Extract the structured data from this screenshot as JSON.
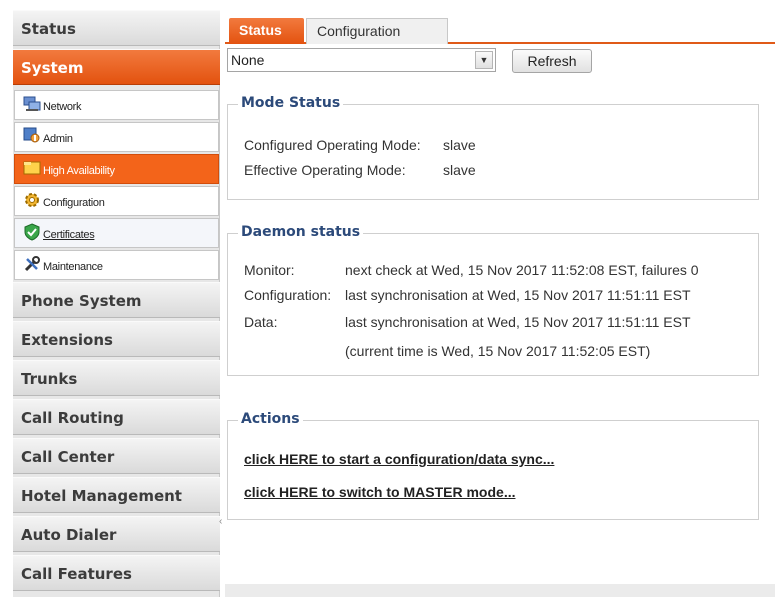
{
  "sidebar": {
    "categories_top": [
      {
        "label": "Status",
        "active": false
      },
      {
        "label": "System",
        "active": true
      }
    ],
    "system_items": [
      {
        "label": "Network",
        "icon": "network-icon",
        "active": false
      },
      {
        "label": "Admin",
        "icon": "admin-icon",
        "active": false
      },
      {
        "label": "High Availability",
        "icon": "high-availability-icon",
        "active": true
      },
      {
        "label": "Configuration",
        "icon": "gear-icon",
        "active": false
      },
      {
        "label": "Certificates",
        "icon": "shield-check-icon",
        "active": false
      },
      {
        "label": "Maintenance",
        "icon": "tools-icon",
        "active": false
      }
    ],
    "categories_bottom": [
      {
        "label": "Phone System"
      },
      {
        "label": "Extensions"
      },
      {
        "label": "Trunks"
      },
      {
        "label": "Call Routing"
      },
      {
        "label": "Call Center"
      },
      {
        "label": "Hotel Management"
      },
      {
        "label": "Auto Dialer"
      },
      {
        "label": "Call Features"
      }
    ]
  },
  "tabs": [
    {
      "label": "Status",
      "active": true
    },
    {
      "label": "Configuration",
      "active": false
    }
  ],
  "toolbar": {
    "select_value": "None",
    "refresh_label": "Refresh"
  },
  "mode_status": {
    "title": "Mode Status",
    "rows": [
      {
        "label": "Configured Operating Mode:",
        "value": "slave"
      },
      {
        "label": "Effective Operating Mode:",
        "value": "slave"
      }
    ]
  },
  "daemon_status": {
    "title": "Daemon status",
    "rows": [
      {
        "label": "Monitor:",
        "value": "next check at Wed, 15 Nov 2017 11:52:08 EST, failures 0"
      },
      {
        "label": "Configuration:",
        "value": "last synchronisation at Wed, 15 Nov 2017 11:51:11 EST"
      },
      {
        "label": "Data:",
        "value": "last synchronisation at Wed, 15 Nov 2017 11:51:11 EST"
      },
      {
        "label": "",
        "value": "(current time is Wed, 15 Nov 2017 11:52:05 EST)"
      }
    ]
  },
  "actions": {
    "title": "Actions",
    "links": [
      "click HERE to start a configuration/data sync...",
      "click HERE to switch to MASTER mode..."
    ]
  },
  "colors": {
    "accent": "#e85a16",
    "legend_text": "#2c4a7a"
  }
}
